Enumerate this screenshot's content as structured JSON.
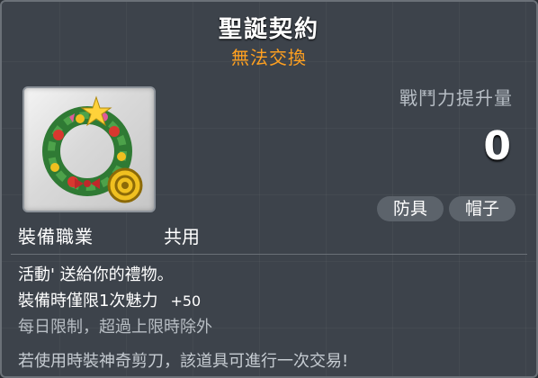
{
  "item": {
    "name": "聖誕契約",
    "trade_status": "無法交換",
    "icon": "christmas-wreath-icon"
  },
  "stats": {
    "power_label": "戰鬥力提升量",
    "power_value": "0"
  },
  "tags": [
    "防具",
    "帽子"
  ],
  "job": {
    "label": "裝備職業",
    "value": "共用"
  },
  "description": {
    "line1": "活動' 送給你的禮物。",
    "line2_prefix": "裝備時僅限1次魅力",
    "line2_bonus": "+50",
    "line3": "每日限制，超過上限時除外",
    "line4": "若使用時裝神奇剪刀，該道具可進行一次交易!"
  },
  "colors": {
    "title": "#ffffff",
    "trade_status": "#ffa020",
    "background": "#3d434b"
  }
}
